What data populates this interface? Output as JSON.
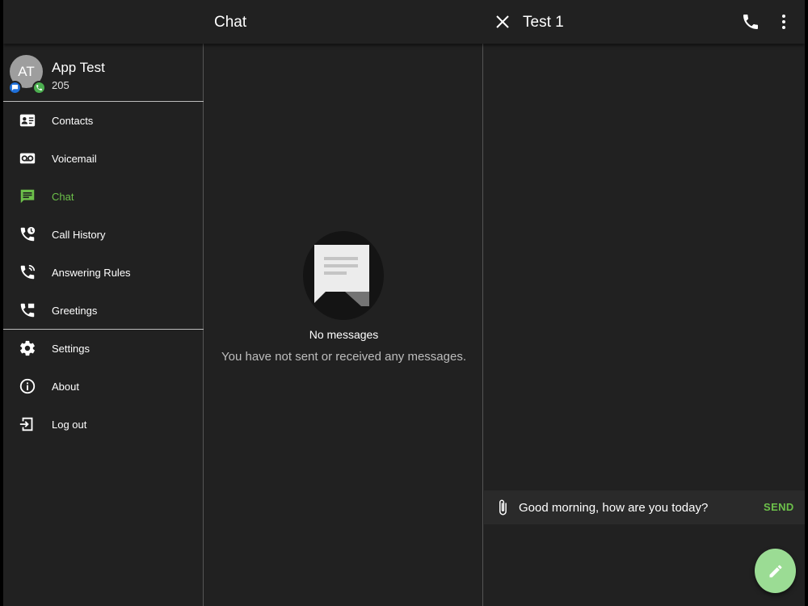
{
  "header": {
    "list_title": "Chat",
    "conversation_title": "Test 1"
  },
  "profile": {
    "initials": "AT",
    "name": "App Test",
    "extension": "205"
  },
  "nav": {
    "items": [
      {
        "label": "Contacts",
        "icon": "contacts-icon"
      },
      {
        "label": "Voicemail",
        "icon": "voicemail-icon"
      },
      {
        "label": "Chat",
        "icon": "chat-icon",
        "active": true
      },
      {
        "label": "Call History",
        "icon": "call-history-icon"
      },
      {
        "label": "Answering Rules",
        "icon": "answering-rules-icon"
      },
      {
        "label": "Greetings",
        "icon": "greetings-icon"
      }
    ],
    "secondary": [
      {
        "label": "Settings",
        "icon": "gear-icon"
      },
      {
        "label": "About",
        "icon": "info-icon"
      },
      {
        "label": "Log out",
        "icon": "logout-icon"
      }
    ]
  },
  "empty_state": {
    "title": "No messages",
    "subtitle": "You have not sent or received any messages."
  },
  "composer": {
    "value": "Good morning, how are you today?",
    "send_label": "SEND"
  },
  "colors": {
    "accent": "#6cc04a",
    "fab": "#9bdc94",
    "background": "#212121",
    "presence_chat": "#1e6fd9",
    "presence_phone": "#4caf50"
  }
}
